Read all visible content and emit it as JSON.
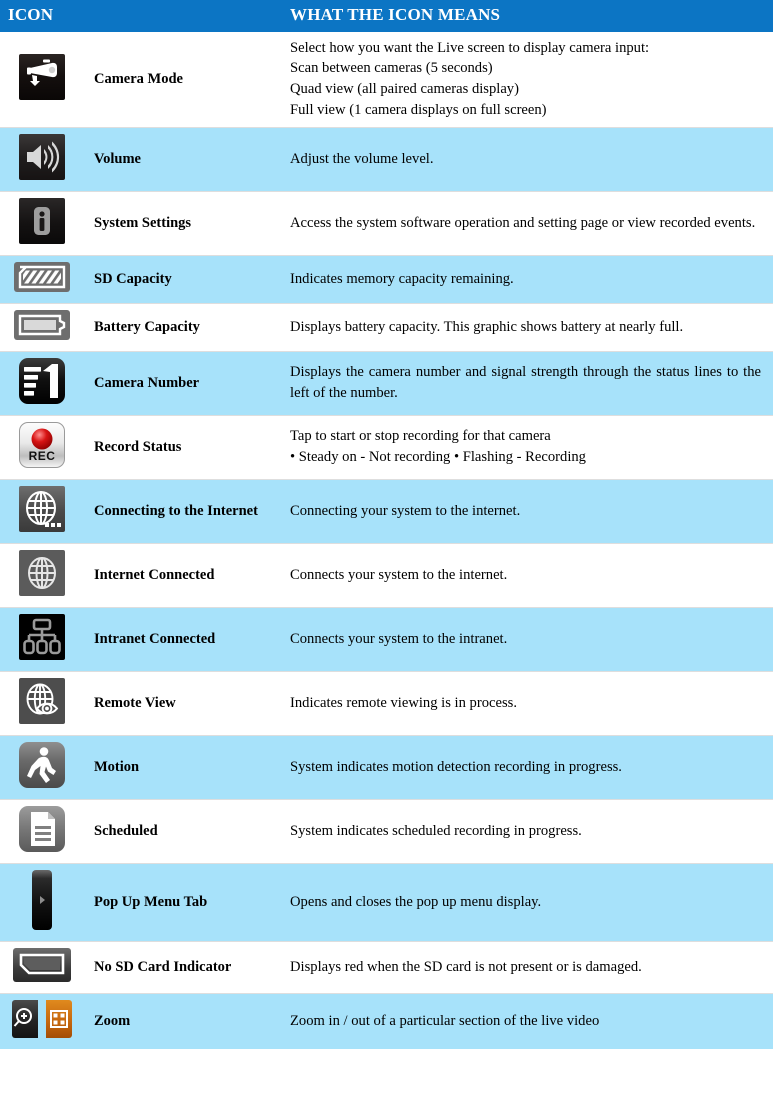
{
  "table": {
    "header": {
      "icon_column": "ICON",
      "meaning_column": "WHAT THE ICON MEANS"
    },
    "colors": {
      "header_blue": "#0c75c4",
      "row_alt": "#a7e2fa",
      "row_plain": "#ffffff",
      "text": "#000000",
      "zoom_orange": "#c4650d",
      "rec_red": "#cc1111"
    },
    "rows": [
      {
        "icon": "security-camera-icon",
        "name": "Camera Mode",
        "desc_lines": [
          "Select how you want the Live screen to display camera input:",
          "Scan between cameras (5 seconds)",
          "Quad view (all paired cameras display)",
          "Full view (1 camera displays on full screen)"
        ]
      },
      {
        "icon": "volume-speaker-icon",
        "name": "Volume",
        "desc_lines": [
          "Adjust the volume level."
        ]
      },
      {
        "icon": "system-settings-info-icon",
        "name": "System Settings",
        "desc_lines": [
          "Access the system software operation and setting page or view recorded events."
        ]
      },
      {
        "icon": "sd-capacity-icon",
        "name": "SD Capacity",
        "desc_lines": [
          "Indicates memory capacity remaining."
        ]
      },
      {
        "icon": "battery-capacity-icon",
        "name": "Battery Capacity",
        "desc_lines": [
          "Displays battery capacity. This graphic shows battery at nearly full."
        ]
      },
      {
        "icon": "camera-number-signal-icon",
        "name": "Camera Number",
        "desc_lines": [
          "Displays the camera number and signal strength through the status lines to the left of the number."
        ]
      },
      {
        "icon": "record-status-rec-icon",
        "name": "Record Status",
        "desc_lines": [
          "Tap to start or stop recording for that camera",
          "• Steady on - Not recording • Flashing - Recording"
        ]
      },
      {
        "icon": "globe-connecting-icon",
        "name": "Connecting to the Internet",
        "desc_lines": [
          "Connecting your system to the internet."
        ]
      },
      {
        "icon": "globe-connected-icon",
        "name": "Internet Connected",
        "desc_lines": [
          "Connects your system to the internet."
        ]
      },
      {
        "icon": "network-intranet-icon",
        "name": "Intranet Connected",
        "desc_lines": [
          "Connects your system to the intranet."
        ]
      },
      {
        "icon": "globe-eye-remote-view-icon",
        "name": "Remote View",
        "desc_lines": [
          "Indicates remote viewing is in process."
        ]
      },
      {
        "icon": "walking-person-motion-icon",
        "name": "Motion",
        "desc_lines": [
          "System indicates motion detection recording in progress."
        ]
      },
      {
        "icon": "document-scheduled-icon",
        "name": "Scheduled",
        "desc_lines": [
          "System indicates scheduled recording in progress."
        ]
      },
      {
        "icon": "pop-up-menu-tab-icon",
        "name": "Pop Up Menu Tab",
        "desc_lines": [
          "Opens and closes the pop up menu display."
        ]
      },
      {
        "icon": "no-sd-card-icon",
        "name": "No SD Card Indicator",
        "desc_lines": [
          "Displays red when the SD card is not present or is damaged."
        ]
      },
      {
        "icon": "zoom-magnifier-icon",
        "name": "Zoom",
        "desc_lines": [
          "Zoom in / out of a particular section of the live video"
        ]
      }
    ],
    "rec_label": "REC",
    "camera_number_label": "1"
  }
}
